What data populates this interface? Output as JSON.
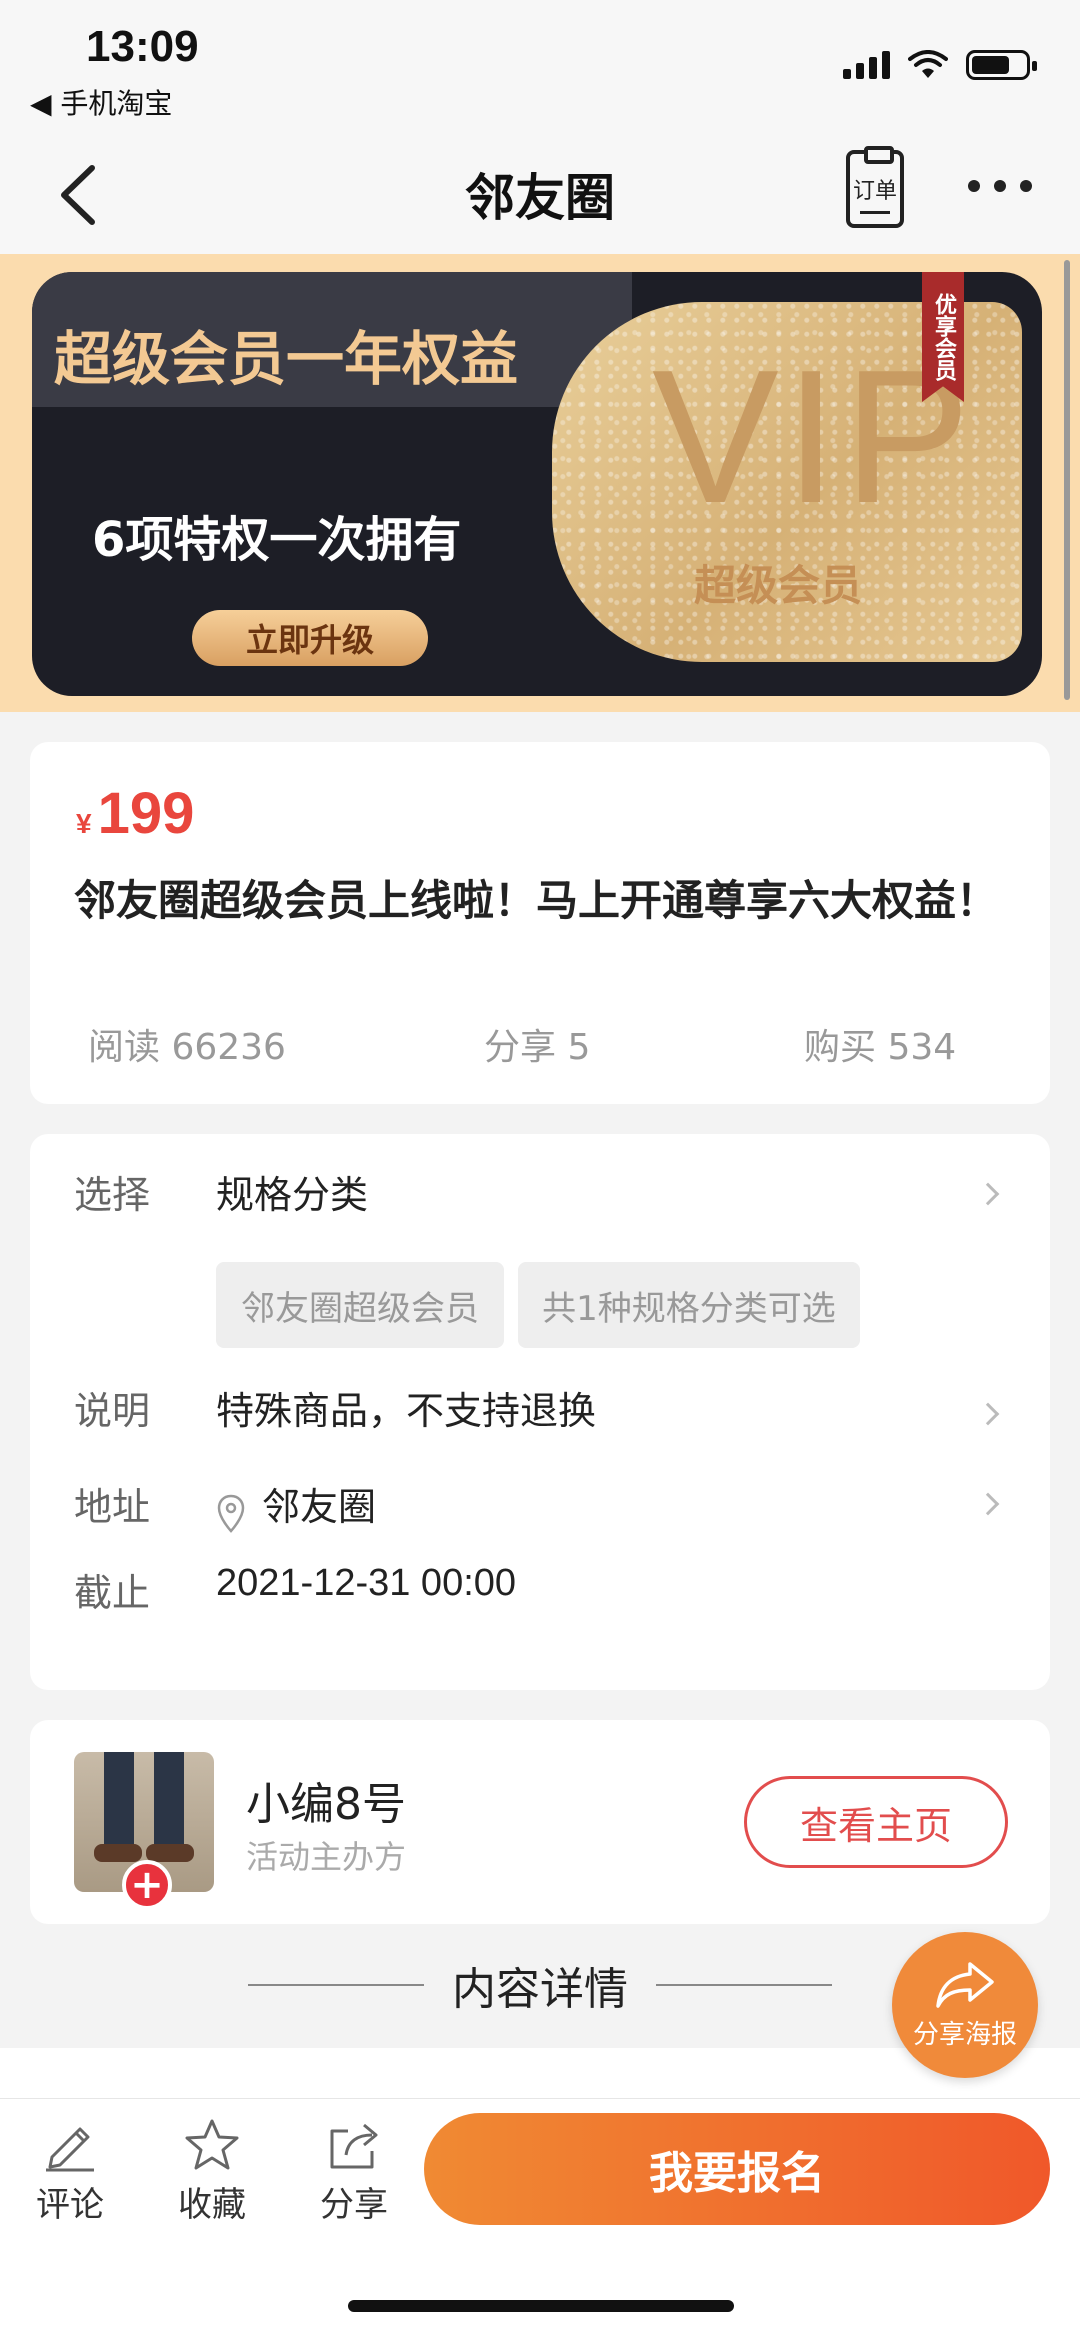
{
  "status": {
    "time": "13:09",
    "back_app": "◀ 手机淘宝"
  },
  "nav": {
    "title": "邻友圈",
    "order_label": "订单"
  },
  "banner": {
    "headline": "超级会员一年权益",
    "subline": "6项特权一次拥有",
    "button": "立即升级",
    "vip": "VIP",
    "vip_sub": "超级会员",
    "ribbon": "优享会员"
  },
  "product": {
    "currency": "¥",
    "price": "199",
    "title": "邻友圈超级会员上线啦！马上开通尊享六大权益！",
    "stats": {
      "reads": "阅读 66236",
      "shares": "分享 5",
      "purchases": "购买 534"
    }
  },
  "spec": {
    "select_label": "选择",
    "select_value": "规格分类",
    "tags": [
      "邻友圈超级会员",
      "共1种规格分类可选"
    ],
    "note_label": "说明",
    "note_value": "特殊商品，不支持退换",
    "address_label": "地址",
    "address_value": "邻友圈",
    "deadline_label": "截止",
    "deadline_value": "2021-12-31 00:00"
  },
  "organizer": {
    "name": "小编8号",
    "role": "活动主办方",
    "home_button": "查看主页"
  },
  "section": {
    "title": "内容详情"
  },
  "share_poster": "分享海报",
  "bottom": {
    "comment": "评论",
    "favorite": "收藏",
    "share": "分享",
    "signup": "我要报名"
  },
  "colors": {
    "accent_red": "#e9463d",
    "signup_gradient_start": "#f08a33",
    "signup_gradient_end": "#f0582a",
    "banner_bg": "#fbdcae"
  }
}
